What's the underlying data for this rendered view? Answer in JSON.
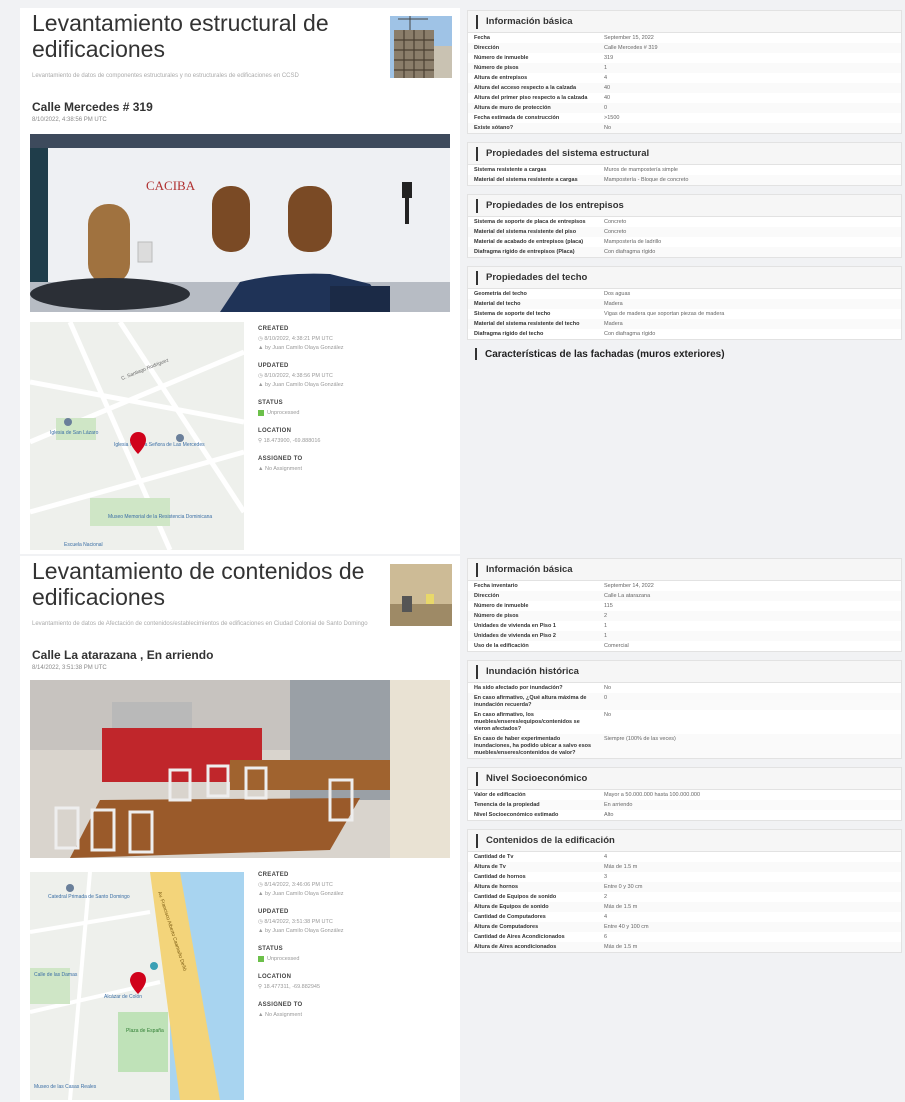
{
  "entry1": {
    "title": "Levantamiento estructural de edificaciones",
    "description": "Levantamiento de datos de componentes estructurales y no estructurales de edificaciones en CCSD",
    "address": "Calle Mercedes # 319",
    "date": "8/10/2022, 4:38:56 PM UTC",
    "meta": {
      "created_label": "CREATED",
      "created_date": "8/10/2022, 4:38:21 PM UTC",
      "created_by": "by Juan Camilo Olaya González",
      "updated_label": "UPDATED",
      "updated_date": "8/10/2022, 4:38:56 PM UTC",
      "updated_by": "by Juan Camilo Olaya González",
      "status_label": "STATUS",
      "status_value": "Unprocessed",
      "location_label": "LOCATION",
      "location_value": "18.473900, -69.888016",
      "assigned_label": "ASSIGNED TO",
      "assigned_value": "No Assignment"
    },
    "map_labels": {
      "street": "C. Santiago Rodríguez",
      "place1": "Iglesia de San Lázaro",
      "place2": "Iglesia Nuestra Señora de Las Mercedes",
      "place3": "Museo Memorial de la Resistencia Dominicana",
      "place4": "Escuela Nacional"
    },
    "sign": "CACIBA"
  },
  "entry2": {
    "title": "Levantamiento de contenidos de edificaciones",
    "description": "Levantamiento de datos de Afectación de contenidos/establecimientos de edificaciones en Ciudad Colonial de Santo Domingo",
    "address": "Calle La atarazana , En arriendo",
    "date": "8/14/2022, 3:51:38 PM UTC",
    "meta": {
      "created_label": "CREATED",
      "created_date": "8/14/2022, 3:46:06 PM UTC",
      "created_by": "by Juan Camilo Olaya González",
      "updated_label": "UPDATED",
      "updated_date": "8/14/2022, 3:51:38 PM UTC",
      "updated_by": "by Juan Camilo Olaya González",
      "status_label": "STATUS",
      "status_value": "Unprocessed",
      "location_label": "LOCATION",
      "location_value": "18.477311, -69.882945",
      "assigned_label": "ASSIGNED TO",
      "assigned_value": "No Assignment"
    },
    "map_labels": {
      "place1": "Catedral Primada de Santo Domingo",
      "place2": "Calle de las Damas",
      "place3": "Museo de las Casas Reales",
      "place4": "Plaza de España",
      "place5": "Alcázar de Colón",
      "road": "Av. Francisco Alberto Caamaño Deñó"
    }
  },
  "right": {
    "panels": [
      {
        "title": "Información básica",
        "rows": [
          [
            "Fecha",
            "September 15, 2022"
          ],
          [
            "Dirección",
            "Calle Mercedes # 319"
          ],
          [
            "Número de inmueble",
            "319"
          ],
          [
            "Número de pisos",
            "1"
          ],
          [
            "Altura de entrepisos",
            "4"
          ],
          [
            "Altura del acceso respecto a la calzada",
            "40"
          ],
          [
            "Altura del primer piso respecto a la calzada",
            "40"
          ],
          [
            "Altura de muro de protección",
            "0"
          ],
          [
            "Fecha estimada de construcción",
            ">1500"
          ],
          [
            "Existe sótano?",
            "No"
          ]
        ]
      },
      {
        "title": "Propiedades del sistema estructural",
        "rows": [
          [
            "Sistema resistente a cargas",
            "Muros de mampostería simple"
          ],
          [
            "Material del sistema resistente a cargas",
            "Mampostería - Bloque de concreto"
          ]
        ]
      },
      {
        "title": "Propiedades de los entrepisos",
        "rows": [
          [
            "Sistema de soporte de placa de entrepisos",
            "Concreto"
          ],
          [
            "Material del sistema resistente del piso",
            "Concreto"
          ],
          [
            "Material de acabado de entrepisos (placa)",
            "Mampostería de ladrillo"
          ],
          [
            "Diafragma rígido de entrepisos (Placa)",
            "Con diafragma rígido"
          ]
        ]
      },
      {
        "title": "Propiedades del techo",
        "rows": [
          [
            "Geometría del techo",
            "Dos aguas"
          ],
          [
            "Material del techo",
            "Madera"
          ],
          [
            "Sistema de soporte del techo",
            "Vigas de madera que soportan piezas de madera"
          ],
          [
            "Material del sistema resistente del techo",
            "Madera"
          ],
          [
            "Diafragma rígido del techo",
            "Con diafragma rígido"
          ]
        ]
      }
    ],
    "section_heading": "Características de las fachadas (muros exteriores)",
    "panels2": [
      {
        "title": "Información básica",
        "rows": [
          [
            "Fecha inventario",
            "September 14, 2022"
          ],
          [
            "Dirección",
            "Calle La atarazana"
          ],
          [
            "Número de inmueble",
            "115"
          ],
          [
            "Número de pisos",
            "2"
          ],
          [
            "Unidades de vivienda en Piso 1",
            "1"
          ],
          [
            "Unidades de vivienda en Piso 2",
            "1"
          ],
          [
            "Uso de la edificación",
            "Comercial"
          ]
        ]
      },
      {
        "title": "Inundación histórica",
        "rows": [
          [
            "Ha sido afectado por inundación?",
            "No"
          ],
          [
            "En caso afirmativo, ¿Qué altura máxima de inundación recuerda?",
            "0"
          ],
          [
            "En caso afirmativo, los muebles/enseres/equipos/contenidos se vieron afectados?",
            "No"
          ],
          [
            "En caso de haber experimentado inundaciones, ha podido ubicar a salvo esos muebles/enseres/contenidos de valor?",
            "Siempre (100% de las veces)"
          ]
        ]
      },
      {
        "title": "Nivel Socioeconómico",
        "rows": [
          [
            "Valor de edificación",
            "Mayor a 50.000.000 hasta 100.000.000"
          ],
          [
            "Tenencia de la propiedad",
            "En arriendo"
          ],
          [
            "Nivel Socioeconómico estimado",
            "Alto"
          ]
        ]
      },
      {
        "title": "Contenidos de la edificación",
        "rows": [
          [
            "Cantidad de Tv",
            "4"
          ],
          [
            "Altura de Tv",
            "Más de 1.5 m"
          ],
          [
            "Cantidad de hornos",
            "3"
          ],
          [
            "Altura de hornos",
            "Entre 0 y 30 cm"
          ],
          [
            "Cantidad de Equipos de sonido",
            "2"
          ],
          [
            "Altura de Equipos de sonido",
            "Más de 1.5 m"
          ],
          [
            "Cantidad de Computadores",
            "4"
          ],
          [
            "Altura de Computadores",
            "Entre 40 y 100 cm"
          ],
          [
            "Cantidad de Aires Acondicionados",
            "6"
          ],
          [
            "Altura de Aires acondicionados",
            "Más de 1.5 m"
          ]
        ]
      }
    ]
  }
}
